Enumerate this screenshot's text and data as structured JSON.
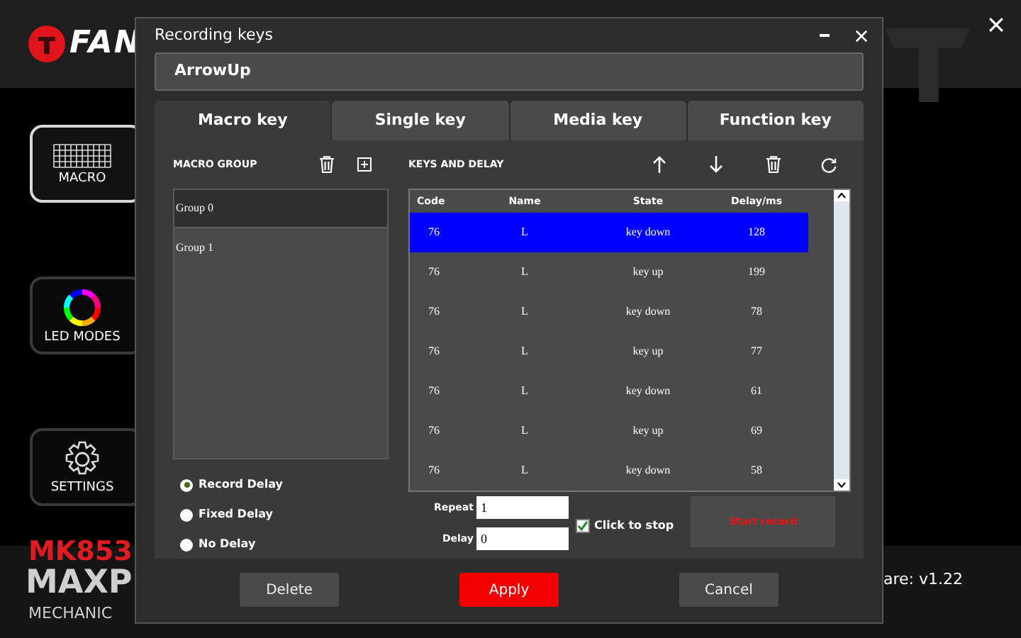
{
  "app": {
    "logo": "FAN",
    "nav": [
      {
        "label": "MACRO",
        "kind": "keyboard",
        "selected": true
      },
      {
        "label": "LED MODES",
        "kind": "ring",
        "selected": false
      },
      {
        "label": "SETTINGS",
        "kind": "gear",
        "selected": false
      }
    ],
    "model": "MK853",
    "product": "MAXP",
    "subtitle": "MECHANIC",
    "firmware": "are: v1.22"
  },
  "dialog": {
    "title": "Recording keys",
    "key_name": "ArrowUp",
    "tabs": [
      {
        "label": "Macro key",
        "selected": true
      },
      {
        "label": "Single key",
        "selected": false
      },
      {
        "label": "Media key",
        "selected": false
      },
      {
        "label": "Function key",
        "selected": false
      }
    ],
    "macro_group": {
      "title": "MACRO GROUP",
      "groups": [
        {
          "label": "Group 0",
          "selected": true
        },
        {
          "label": "Group 1",
          "selected": false
        }
      ]
    },
    "delay_options": [
      {
        "label": "Record Delay",
        "selected": true
      },
      {
        "label": "Fixed Delay",
        "selected": false
      },
      {
        "label": "No Delay",
        "selected": false
      }
    ],
    "keys_and_delay": {
      "title": "KEYS AND DELAY",
      "columns": [
        "Code",
        "Name",
        "State",
        "Delay/ms"
      ],
      "rows": [
        {
          "cells": [
            "76",
            "L",
            "key down",
            "128"
          ],
          "selected": true
        },
        {
          "cells": [
            "76",
            "L",
            "key up",
            "199"
          ],
          "selected": false
        },
        {
          "cells": [
            "76",
            "L",
            "key down",
            "78"
          ],
          "selected": false
        },
        {
          "cells": [
            "76",
            "L",
            "key up",
            "77"
          ],
          "selected": false
        },
        {
          "cells": [
            "76",
            "L",
            "key down",
            "61"
          ],
          "selected": false
        },
        {
          "cells": [
            "76",
            "L",
            "key up",
            "69"
          ],
          "selected": false
        },
        {
          "cells": [
            "76",
            "L",
            "key down",
            "58"
          ],
          "selected": false
        }
      ]
    },
    "repeat": {
      "label": "Repeat",
      "value": "1"
    },
    "delay": {
      "label": "Delay",
      "value": "0"
    },
    "click_to_stop": {
      "label": "Click to stop",
      "checked": true
    },
    "start_record": "Start record",
    "buttons": [
      {
        "label": "Delete",
        "kind": "secondary"
      },
      {
        "label": "Apply",
        "kind": "primary"
      },
      {
        "label": "Cancel",
        "kind": "secondary"
      }
    ]
  }
}
